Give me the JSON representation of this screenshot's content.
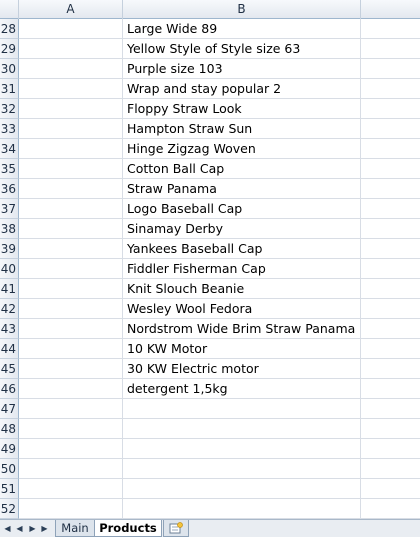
{
  "columns": [
    "A",
    "B"
  ],
  "rows": [
    {
      "num": "28",
      "b": "Large Wide 89"
    },
    {
      "num": "29",
      "b": "Yellow  Style of Style size 63"
    },
    {
      "num": "30",
      "b": "Purple size 103"
    },
    {
      "num": "31",
      "b": "Wrap and stay popular 2"
    },
    {
      "num": "32",
      "b": "Floppy Straw Look"
    },
    {
      "num": "33",
      "b": "Hampton Straw Sun"
    },
    {
      "num": "34",
      "b": "Hinge Zigzag Woven"
    },
    {
      "num": "35",
      "b": "Cotton Ball Cap"
    },
    {
      "num": "36",
      "b": "Straw Panama"
    },
    {
      "num": "37",
      "b": "Logo Baseball Cap"
    },
    {
      "num": "38",
      "b": "Sinamay Derby"
    },
    {
      "num": "39",
      "b": "Yankees Baseball Cap"
    },
    {
      "num": "40",
      "b": "Fiddler Fisherman Cap"
    },
    {
      "num": "41",
      "b": "Knit Slouch Beanie"
    },
    {
      "num": "42",
      "b": "Wesley Wool Fedora"
    },
    {
      "num": "43",
      "b": "Nordstrom Wide Brim Straw Panama"
    },
    {
      "num": "44",
      "b": "10 KW Motor"
    },
    {
      "num": "45",
      "b": "30 KW Electric motor"
    },
    {
      "num": "46",
      "b": "detergent 1,5kg"
    },
    {
      "num": "47",
      "b": ""
    },
    {
      "num": "48",
      "b": ""
    },
    {
      "num": "49",
      "b": ""
    },
    {
      "num": "50",
      "b": ""
    },
    {
      "num": "51",
      "b": ""
    },
    {
      "num": "52",
      "b": ""
    }
  ],
  "tabs": [
    {
      "label": "Main",
      "active": false
    },
    {
      "label": "Products",
      "active": true
    }
  ],
  "icons": {
    "first": "first-sheet-icon",
    "prev": "prev-sheet-icon",
    "next": "next-sheet-icon",
    "last": "last-sheet-icon",
    "new_sheet": "insert-sheet-icon"
  },
  "colors": {
    "header_bg": "#e4e9f0",
    "header_border": "#9eb6ce",
    "grid_line": "#d8dde5",
    "active_tab": "#ffffff"
  }
}
